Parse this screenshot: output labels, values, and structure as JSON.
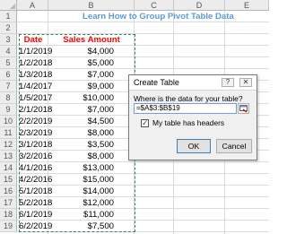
{
  "columns": [
    "A",
    "B",
    "C",
    "D",
    "E"
  ],
  "rows": [
    "1",
    "2",
    "3",
    "4",
    "5",
    "6",
    "7",
    "8",
    "9",
    "10",
    "11",
    "12",
    "13",
    "14",
    "15",
    "16",
    "17",
    "18",
    "19"
  ],
  "sheet_title": "Learn How to Group Pivot Table Data",
  "table": {
    "headers": [
      "Date",
      "Sales Amount"
    ],
    "rows": [
      [
        "1/1/2019",
        "$4,000"
      ],
      [
        "1/2/2018",
        "$5,000"
      ],
      [
        "1/3/2018",
        "$7,000"
      ],
      [
        "1/4/2017",
        "$9,000"
      ],
      [
        "1/5/2017",
        "$10,000"
      ],
      [
        "2/1/2018",
        "$7,000"
      ],
      [
        "2/2/2019",
        "$4,500"
      ],
      [
        "2/3/2019",
        "$8,000"
      ],
      [
        "3/1/2018",
        "$3,500"
      ],
      [
        "3/2/2016",
        "$8,000"
      ],
      [
        "4/1/2016",
        "$13,000"
      ],
      [
        "4/2/2016",
        "$15,000"
      ],
      [
        "5/1/2018",
        "$14,000"
      ],
      [
        "5/2/2018",
        "$12,000"
      ],
      [
        "6/1/2019",
        "$11,000"
      ],
      [
        "6/2/2019",
        "$7,500"
      ]
    ]
  },
  "dialog": {
    "title": "Create Table",
    "help_label": "?",
    "close_label": "✕",
    "prompt": "Where is the data for your table?",
    "range_value": "=$A$3:$B$19",
    "checkbox_label": "My table has headers",
    "checkbox_checked": true,
    "check_mark": "✓",
    "ok_label": "OK",
    "cancel_label": "Cancel"
  },
  "colors": {
    "header_text": "#ff0000",
    "title_text": "#5b9bd5",
    "marquee": "#2e8b57"
  }
}
